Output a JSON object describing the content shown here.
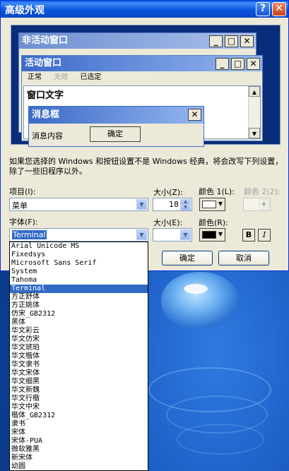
{
  "window": {
    "title": "高级外观",
    "help_glyph": "?",
    "close_glyph": "✕"
  },
  "preview": {
    "inactive_title": "非活动窗口",
    "active_title": "活动窗口",
    "menu": [
      "正常",
      "无效",
      "已选定"
    ],
    "window_text": "窗口文字",
    "msgbox_title": "消息框",
    "msgbox_content": "消息内容",
    "msgbox_ok": "确定",
    "caption_buttons": {
      "minimize": "_",
      "maximize": "□",
      "close": "✕"
    }
  },
  "description": "如果您选择的 Windows 和按钮设置不是 Windows 经典，将会改写下列设置，除了一些旧程序以外。",
  "item": {
    "label": "项目(I):",
    "value": "菜单"
  },
  "size1": {
    "label": "大小(Z):",
    "value": "18"
  },
  "color1": {
    "label": "颜色 1(L):",
    "color": "#ffffff"
  },
  "color2": {
    "label": "颜色 2(2):"
  },
  "font": {
    "label": "字体(F):",
    "value": "Terminal"
  },
  "size2": {
    "label": "大小(E):",
    "value": ""
  },
  "color3": {
    "label": "颜色(R):",
    "color": "#000000"
  },
  "bold_label": "B",
  "italic_label": "I",
  "ok_label": "确定",
  "cancel_label": "取消",
  "font_list": {
    "selected": "Terminal",
    "items": [
      "Arial Unicode MS",
      "Fixedsys",
      "Microsoft Sans Serif",
      "System",
      "Tahoma",
      "Terminal",
      "方正舒体",
      "方正姚体",
      "仿宋_GB2312",
      "黑体",
      "华文彩云",
      "华文仿宋",
      "华文琥珀",
      "华文楷体",
      "华文隶书",
      "华文宋体",
      "华文细黑",
      "华文新魏",
      "华文行楷",
      "华文中宋",
      "楷体_GB2312",
      "隶书",
      "宋体",
      "宋体-PUA",
      "微软雅黑",
      "新宋体",
      "幼圆"
    ]
  }
}
